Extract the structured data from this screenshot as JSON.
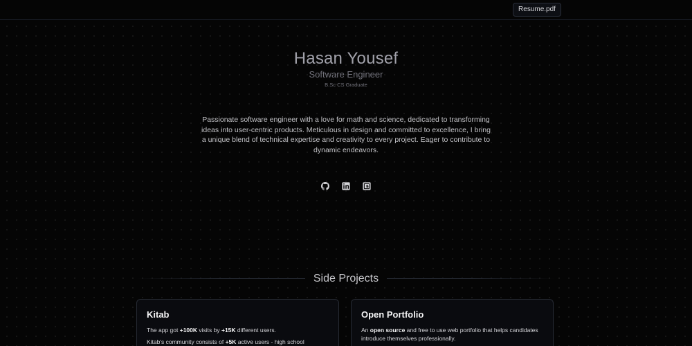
{
  "header": {
    "resume_label": "Resume.pdf"
  },
  "hero": {
    "name": "Hasan Yousef",
    "role": "Software Engineer",
    "degree": "B.Sc CS Graduate",
    "bio": "Passionate software engineer with a love for math and science, dedicated to transforming ideas into user-centric products. Meticulous in design and committed to excellence, I bring a unique blend of technical expertise and creativity to every project. Eager to contribute to dynamic endeavors."
  },
  "socials": [
    {
      "icon": "github-icon"
    },
    {
      "icon": "linkedin-icon"
    },
    {
      "icon": "google-scholar-icon"
    }
  ],
  "projects_section": {
    "title": "Side Projects",
    "cards": [
      {
        "title": "Kitab",
        "line1": {
          "pre": "The app got ",
          "b1": "+100K",
          "mid": " visits by ",
          "b2": "+15K",
          "post": " different users."
        },
        "line2": {
          "pre": "Kitab's community consists of ",
          "b1": "+5K",
          "post": " active users - high school"
        }
      },
      {
        "title": "Open Portfolio",
        "line1": {
          "pre": "An ",
          "b1": "open source",
          "post": " and free to use web portfolio that helps candidates introduce themselves professionally."
        }
      }
    ]
  },
  "colors": {
    "background": "#050505",
    "card_border": "#262a33",
    "name_text": "#a1a1aa"
  }
}
